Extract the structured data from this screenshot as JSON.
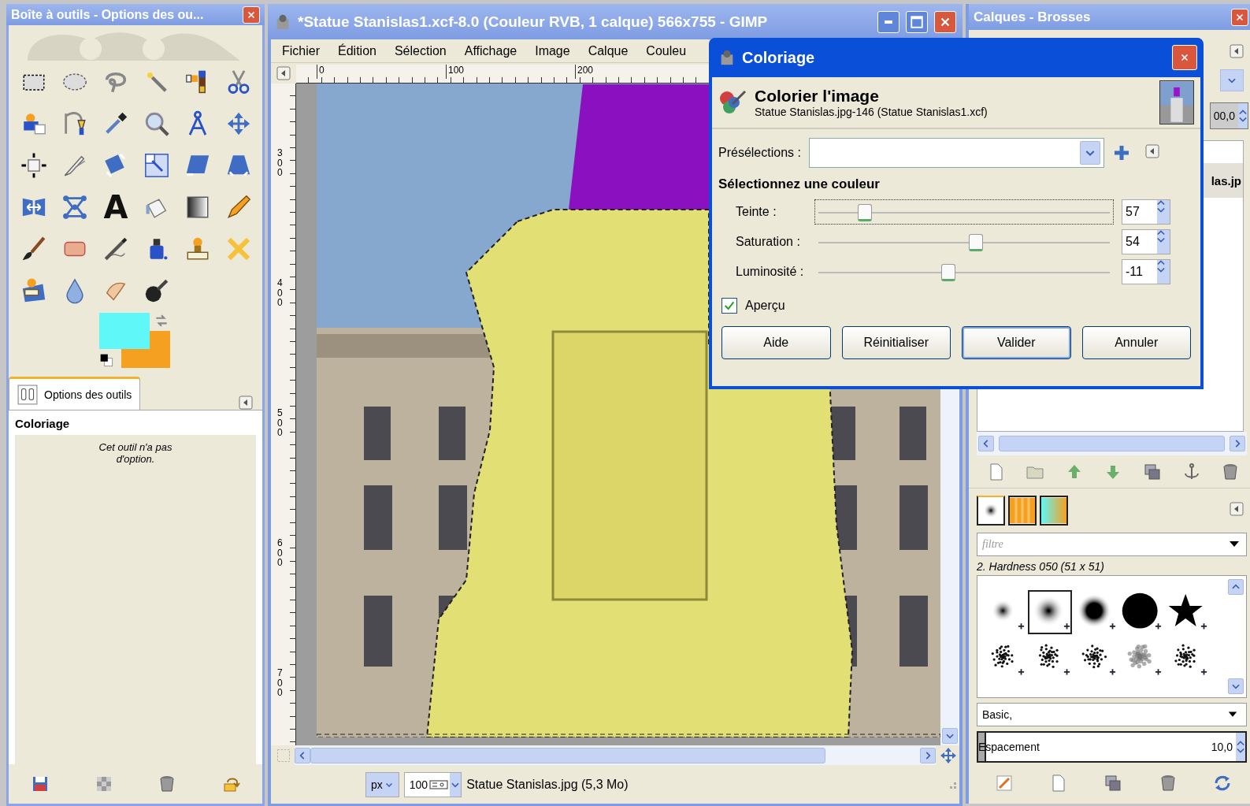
{
  "toolbox": {
    "title": "Boîte à outils - Options des ou...",
    "text_tool_glyph": "A",
    "colors": [
      {
        "kind": "foreground",
        "color": "#5ff7f7"
      },
      {
        "kind": "background",
        "color": "#f5a020"
      }
    ],
    "options_tab": {
      "label": "Options des outils",
      "selected": true
    },
    "tool_name": "Coloriage",
    "options_message": "Cet outil n'a pas d'option."
  },
  "image_window": {
    "title": "*Statue Stanislas1.xcf-8.0 (Couleur RVB, 1 calque) 566x755 - GIMP",
    "menu": [
      "Fichier",
      "Édition",
      "Sélection",
      "Affichage",
      "Image",
      "Calque",
      "Couleu"
    ],
    "hruler": [
      "0",
      "100",
      "200"
    ],
    "vruler": [
      "300",
      "400",
      "500",
      "600",
      "700"
    ],
    "status": {
      "unit": "px",
      "zoom": "100",
      "file_info": "Statue Stanislas.jpg (5,3 Mo)"
    }
  },
  "dock": {
    "title": "Calques - Brosses",
    "opacity_value": "00,0",
    "layer_name": "las.jp",
    "brush_tabs": [
      {
        "kind": "brushes",
        "selected": true
      },
      {
        "kind": "patterns",
        "selected": false
      },
      {
        "kind": "gradients",
        "selected": false
      }
    ],
    "filter_placeholder": "filtre",
    "brush_title": "2. Hardness 050 (51 x 51)",
    "brushes": [
      {
        "kind": "soft-small",
        "selected": false
      },
      {
        "kind": "soft",
        "selected": true
      },
      {
        "kind": "soft-large",
        "selected": false
      },
      {
        "kind": "hard",
        "selected": false
      },
      {
        "kind": "star",
        "selected": false
      },
      {
        "kind": "splatter",
        "selected": false
      },
      {
        "kind": "splatter",
        "selected": false
      },
      {
        "kind": "splatter",
        "selected": false
      },
      {
        "kind": "cloud",
        "selected": false
      },
      {
        "kind": "splatter",
        "selected": false
      }
    ],
    "tag": "Basic,",
    "spacing": {
      "label": "Espacement",
      "value": "10,0",
      "level": 0.03
    }
  },
  "dialog": {
    "title": "Coloriage",
    "heading": "Colorier l'image",
    "subheading": "Statue Stanislas.jpg-146 (Statue Stanislas1.xcf)",
    "presets_label": "Présélections :",
    "section_title": "Sélectionnez une couleur",
    "sliders": [
      {
        "label": "Teinte :",
        "value": "57",
        "level": 0.16,
        "focused": true
      },
      {
        "label": "Saturation :",
        "value": "54",
        "level": 0.54,
        "focused": false
      },
      {
        "label": "Luminosité :",
        "value": "-11",
        "level": 0.445,
        "focused": false
      }
    ],
    "preview": {
      "label": "Aperçu",
      "checked": true
    },
    "buttons": [
      {
        "label": "Aide",
        "default": false
      },
      {
        "label": "Réinitialiser",
        "default": false
      },
      {
        "label": "Valider",
        "default": true
      },
      {
        "label": "Annuler",
        "default": false
      }
    ]
  }
}
